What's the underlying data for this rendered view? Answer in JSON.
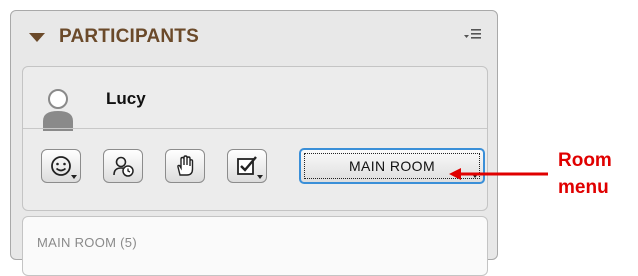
{
  "panel": {
    "title": "PARTICIPANTS",
    "collapse_icon": "triangle-down-icon",
    "menu_icon": "panel-options-icon"
  },
  "user": {
    "name": "Lucy",
    "avatar_icon": "user-silhouette-icon"
  },
  "toolbar": {
    "buttons": [
      {
        "icon": "smiley-status-icon"
      },
      {
        "icon": "user-clock-icon"
      },
      {
        "icon": "raise-hand-icon"
      },
      {
        "icon": "checkbox-check-icon"
      }
    ],
    "room_menu_label": "MAIN ROOM"
  },
  "list": {
    "heading": "MAIN ROOM (5)"
  },
  "callout": {
    "line1": "Room",
    "line2": "menu",
    "color": "#e00000"
  },
  "colors": {
    "title_brown": "#6b4a2a",
    "focus_blue": "#3a8fd8"
  }
}
